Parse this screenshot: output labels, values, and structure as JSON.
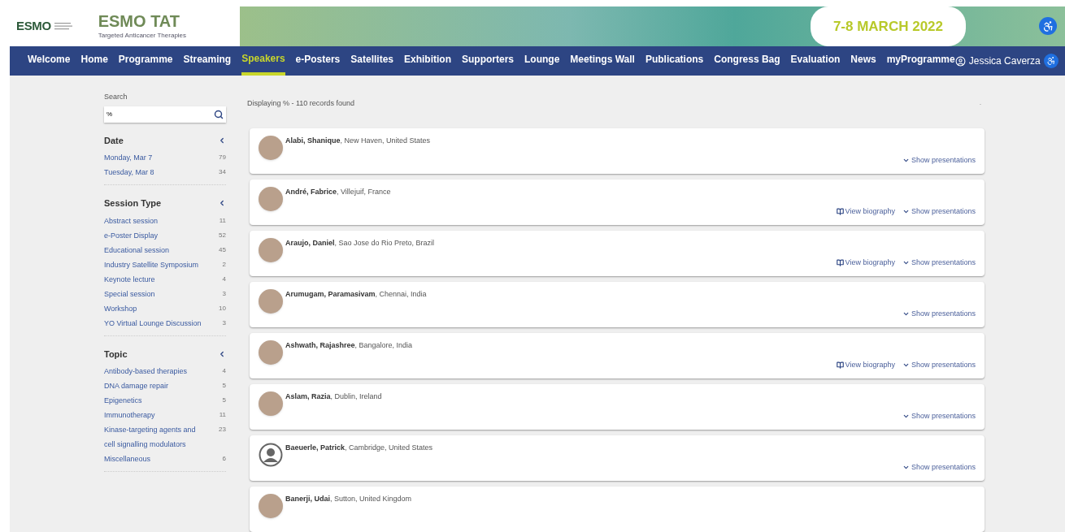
{
  "header": {
    "logo_text": "ESMO",
    "brand": "ESMO TAT",
    "subtitle": "Targeted Anticancer Therapies",
    "date": "7-8 MARCH 2022"
  },
  "nav": {
    "items": [
      {
        "label": "Welcome",
        "selected": false
      },
      {
        "label": "Home",
        "selected": false
      },
      {
        "label": "Programme",
        "selected": false
      },
      {
        "label": "Streaming",
        "selected": false
      },
      {
        "label": "Speakers",
        "selected": true
      },
      {
        "label": "e-Posters",
        "selected": false
      },
      {
        "label": "Satellites",
        "selected": false
      },
      {
        "label": "Exhibition",
        "selected": false
      },
      {
        "label": "Supporters",
        "selected": false
      },
      {
        "label": "Lounge",
        "selected": false
      },
      {
        "label": "Meetings Wall",
        "selected": false
      },
      {
        "label": "Publications",
        "selected": false
      },
      {
        "label": "Congress Bag",
        "selected": false
      },
      {
        "label": "Evaluation",
        "selected": false
      },
      {
        "label": "News",
        "selected": false
      },
      {
        "label": "myProgramme",
        "selected": false
      }
    ],
    "user": "Jessica Caverza"
  },
  "sidebar": {
    "search_label": "Search",
    "search_value": "%",
    "groups": [
      {
        "title": "Date",
        "items": [
          {
            "label": "Monday, Mar 7",
            "count": "79"
          },
          {
            "label": "Tuesday, Mar 8",
            "count": "34"
          }
        ]
      },
      {
        "title": "Session Type",
        "items": [
          {
            "label": "Abstract session",
            "count": "11"
          },
          {
            "label": "e-Poster Display",
            "count": "52"
          },
          {
            "label": "Educational session",
            "count": "45"
          },
          {
            "label": "Industry Satellite Symposium",
            "count": "2"
          },
          {
            "label": "Keynote lecture",
            "count": "4"
          },
          {
            "label": "Special session",
            "count": "3"
          },
          {
            "label": "Workshop",
            "count": "10"
          },
          {
            "label": "YO Virtual Lounge Discussion",
            "count": "3"
          }
        ]
      },
      {
        "title": "Topic",
        "items": [
          {
            "label": "Antibody-based therapies",
            "count": "4"
          },
          {
            "label": "DNA damage repair",
            "count": "5"
          },
          {
            "label": "Epigenetics",
            "count": "5"
          },
          {
            "label": "Immunotherapy",
            "count": "11"
          },
          {
            "label": "Kinase-targeting agents and cell signalling modulators",
            "count": "23"
          },
          {
            "label": "Miscellaneous",
            "count": "6"
          }
        ]
      }
    ]
  },
  "results": {
    "summary": "Displaying % - 110 records found",
    "aside": "-",
    "speakers": [
      {
        "text": "**Alabi, Shanique**, New Haven, United States",
        "kind": "photo",
        "actions": [
          {
            "kind": "presentations",
            "label": "Show presentations"
          }
        ]
      },
      {
        "text": "**André, Fabrice**, Villejuif, France",
        "kind": "photo",
        "actions": [
          {
            "kind": "biography",
            "label": "View biography"
          },
          {
            "kind": "presentations",
            "label": "Show presentations"
          }
        ]
      },
      {
        "text": "**Araujo, Daniel**, Sao Jose do Rio Preto, Brazil",
        "kind": "photo",
        "actions": [
          {
            "kind": "biography",
            "label": "View biography"
          },
          {
            "kind": "presentations",
            "label": "Show presentations"
          }
        ]
      },
      {
        "text": "**Arumugam, Paramasivam**, Chennai, India",
        "kind": "photo",
        "actions": [
          {
            "kind": "presentations",
            "label": "Show presentations"
          }
        ]
      },
      {
        "text": "**Ashwath, Rajashree**, Bangalore, India",
        "kind": "photo",
        "actions": [
          {
            "kind": "biography",
            "label": "View biography"
          },
          {
            "kind": "presentations",
            "label": "Show presentations"
          }
        ]
      },
      {
        "text": "**Aslam, Razia**, Dublin, Ireland",
        "kind": "photo",
        "actions": [
          {
            "kind": "presentations",
            "label": "Show presentations"
          }
        ]
      },
      {
        "text": "**Baeuerle, Patrick**, Cambridge, United States",
        "kind": "silhouette",
        "actions": [
          {
            "kind": "presentations",
            "label": "Show presentations"
          }
        ]
      },
      {
        "text": "**Banerji, Udai**, Sutton, United Kingdom",
        "kind": "photo"
      }
    ]
  }
}
